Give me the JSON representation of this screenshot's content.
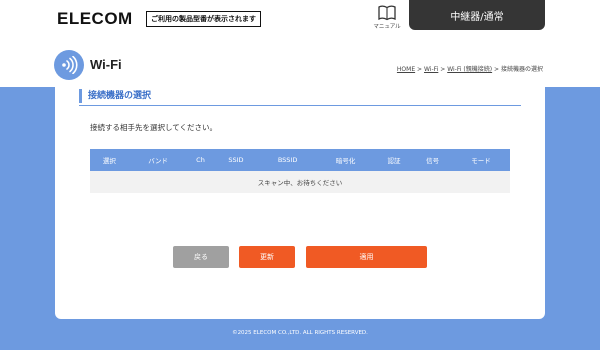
{
  "header": {
    "logo": "ELECOM",
    "model_notice": "ご利用の製品型番が表示されます",
    "manual_label": "マニュアル",
    "mode_tab": "中継器/通常"
  },
  "title_row": {
    "icon": "wifi-icon",
    "title": "Wi-Fi",
    "breadcrumb": [
      {
        "label": "HOME",
        "link": true
      },
      {
        "label": "Wi-Fi",
        "link": true
      },
      {
        "label": "Wi-Fi (親機接続)",
        "link": true
      },
      {
        "label": "接続機器の選択",
        "link": false
      }
    ],
    "breadcrumb_separator": ">"
  },
  "content": {
    "section_title": "接続機器の選択",
    "instruction": "接続する相手先を選択してください。",
    "table": {
      "headers": [
        "選択",
        "バンド",
        "Ch",
        "SSID",
        "BSSID",
        "暗号化",
        "認証",
        "信号",
        "モード"
      ],
      "status_row": "スキャン中、お待ちください"
    },
    "buttons": {
      "back": "戻る",
      "refresh": "更新",
      "apply": "適用"
    }
  },
  "footer": {
    "copyright": "©2025 ELECOM CO.,LTD. ALL RIGHTS RESERVED."
  },
  "colors": {
    "accent_blue": "#6d9ae0",
    "orange": "#f05a24",
    "gray_button": "#a0a0a0",
    "mode_tab": "#353535"
  }
}
